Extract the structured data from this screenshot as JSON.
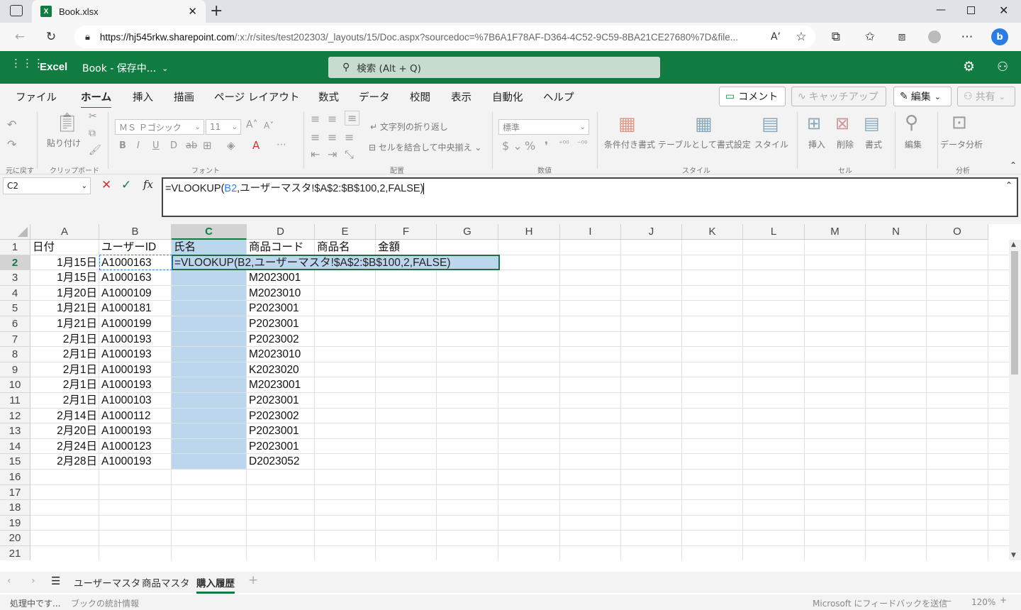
{
  "browser": {
    "tab_title": "Book.xlsx",
    "url": "https://hj545rkw.sharepoint.com/:x:/r/sites/test202303/_layouts/15/Doc.aspx?sourcedoc=%7B6A1F78AF-D364-4C52-9C59-8BA21CE27680%7D&file...",
    "url_host": "https://hj545rkw.sharepoint.com",
    "url_path": "/:x:/r/sites/test202303/_layouts/15/Doc.aspx?sourcedoc=%7B6A1F78AF-D364-4C52-9C59-8BA21CE27680%7D&file..."
  },
  "app": {
    "name": "Excel",
    "doc_title": "Book - 保存中...",
    "search_placeholder": "検索 (Alt + Q)"
  },
  "menu": {
    "items": [
      "ファイル",
      "ホーム",
      "挿入",
      "描画",
      "ページ レイアウト",
      "数式",
      "データ",
      "校閲",
      "表示",
      "自動化",
      "ヘルプ"
    ],
    "active": "ホーム",
    "comment_btn": "コメント",
    "catchup_btn": "キャッチアップ",
    "edit_btn": "編集",
    "share_btn": "共有"
  },
  "ribbon": {
    "undo_group": "元に戻す",
    "clipboard_group": "クリップボード",
    "paste_label": "貼り付け",
    "font_group": "フォント",
    "font_name": "ＭＳ Ｐゴシック",
    "font_size": "11",
    "align_group": "配置",
    "wrap_text": "文字列の折り返し",
    "merge_center": "セルを結合して中央揃え",
    "number_group": "数値",
    "number_format": "標準",
    "style_group": "スタイル",
    "cond_format": "条件付き書式",
    "table_format": "テーブルとして書式設定",
    "styles_btn": "スタイル",
    "cells_group": "セル",
    "insert_btn": "挿入",
    "delete_btn": "削除",
    "format_btn": "書式",
    "edit_label": "編集",
    "analysis_group": "分析",
    "data_analysis": "データ分析"
  },
  "formula_bar": {
    "name_box": "C2",
    "formula_prefix": "=VLOOKUP(",
    "formula_ref": "B2",
    "formula_suffix": ",ユーザーマスタ!$A$2:$B$100,2,FALSE)"
  },
  "grid": {
    "columns": [
      "A",
      "B",
      "C",
      "D",
      "E",
      "F",
      "G",
      "H",
      "I",
      "J",
      "K",
      "L",
      "M",
      "N",
      "O"
    ],
    "selected_column": "C",
    "rows": [
      "1",
      "2",
      "3",
      "4",
      "5",
      "6",
      "7",
      "8",
      "9",
      "10",
      "11",
      "12",
      "13",
      "14",
      "15",
      "16",
      "17",
      "18",
      "19",
      "20",
      "21"
    ],
    "selected_row": "2",
    "headers": [
      "日付",
      "ユーザーID",
      "氏名",
      "商品コード",
      "商品名",
      "金額"
    ],
    "data": [
      {
        "date": "1月15日",
        "user_id": "A1000163",
        "code": ""
      },
      {
        "date": "1月15日",
        "user_id": "A1000163",
        "code": "M2023001"
      },
      {
        "date": "1月20日",
        "user_id": "A1000109",
        "code": "M2023010"
      },
      {
        "date": "1月21日",
        "user_id": "A1000181",
        "code": "P2023001"
      },
      {
        "date": "1月21日",
        "user_id": "A1000199",
        "code": "P2023001"
      },
      {
        "date": "2月1日",
        "user_id": "A1000193",
        "code": "P2023002"
      },
      {
        "date": "2月1日",
        "user_id": "A1000193",
        "code": "M2023010"
      },
      {
        "date": "2月1日",
        "user_id": "A1000193",
        "code": "K2023020"
      },
      {
        "date": "2月1日",
        "user_id": "A1000193",
        "code": "M2023001"
      },
      {
        "date": "2月1日",
        "user_id": "A1000103",
        "code": "P2023001"
      },
      {
        "date": "2月14日",
        "user_id": "A1000112",
        "code": "P2023002"
      },
      {
        "date": "2月20日",
        "user_id": "A1000193",
        "code": "P2023001"
      },
      {
        "date": "2月24日",
        "user_id": "A1000123",
        "code": "P2023001"
      },
      {
        "date": "2月28日",
        "user_id": "A1000193",
        "code": "D2023052"
      }
    ],
    "editing_cell_text": "=VLOOKUP(B2,ユーザーマスタ!$A$2:$B$100,2,FALSE)"
  },
  "sheets": {
    "tabs": [
      "ユーザーマスタ",
      "商品マスタ",
      "購入履歴"
    ],
    "active": "購入履歴"
  },
  "status": {
    "left": "処理中です...",
    "stats": "ブックの統計情報",
    "feedback": "Microsoft にフィードバックを送信",
    "zoom": "120%"
  },
  "colors": {
    "excel_green": "#107c41",
    "selection_fill": "#bcd6ee",
    "ref_blue": "#3a7fd5"
  }
}
